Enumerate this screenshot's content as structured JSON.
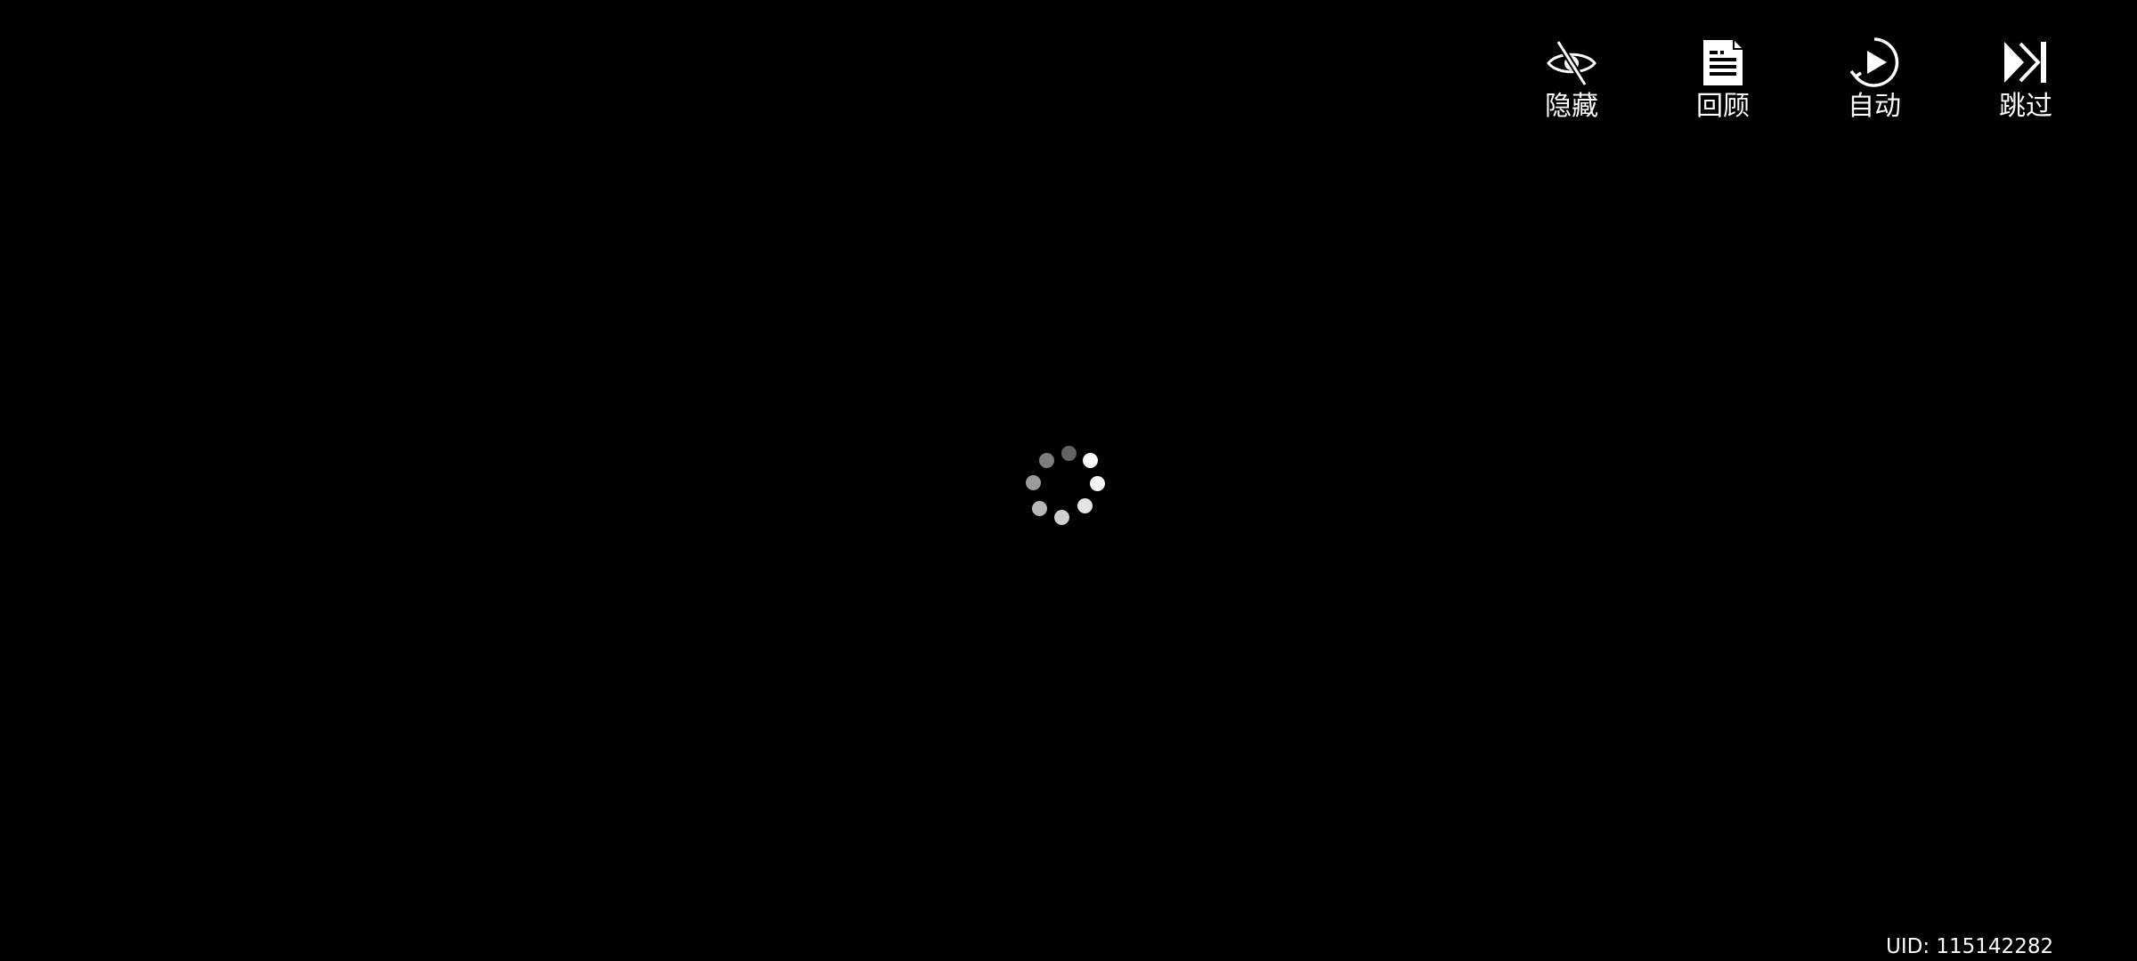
{
  "toolbar": {
    "hide": {
      "label": "隐藏",
      "icon": "eye-slash-icon"
    },
    "review": {
      "label": "回顾",
      "icon": "document-icon"
    },
    "auto": {
      "label": "自动",
      "icon": "play-circle-icon"
    },
    "skip": {
      "label": "跳过",
      "icon": "skip-forward-icon"
    }
  },
  "loading": {
    "icon": "loading-spinner-icon",
    "dot_colors": [
      "#ffffff",
      "#f4f4f4",
      "#e4e4e4",
      "#cfcfcf",
      "#b8b8b8",
      "#9c9c9c",
      "#7e7e7e",
      "#636363"
    ]
  },
  "footer": {
    "uid_text": "UID: 115142282"
  },
  "colors": {
    "background": "#000000",
    "foreground": "#ffffff"
  }
}
